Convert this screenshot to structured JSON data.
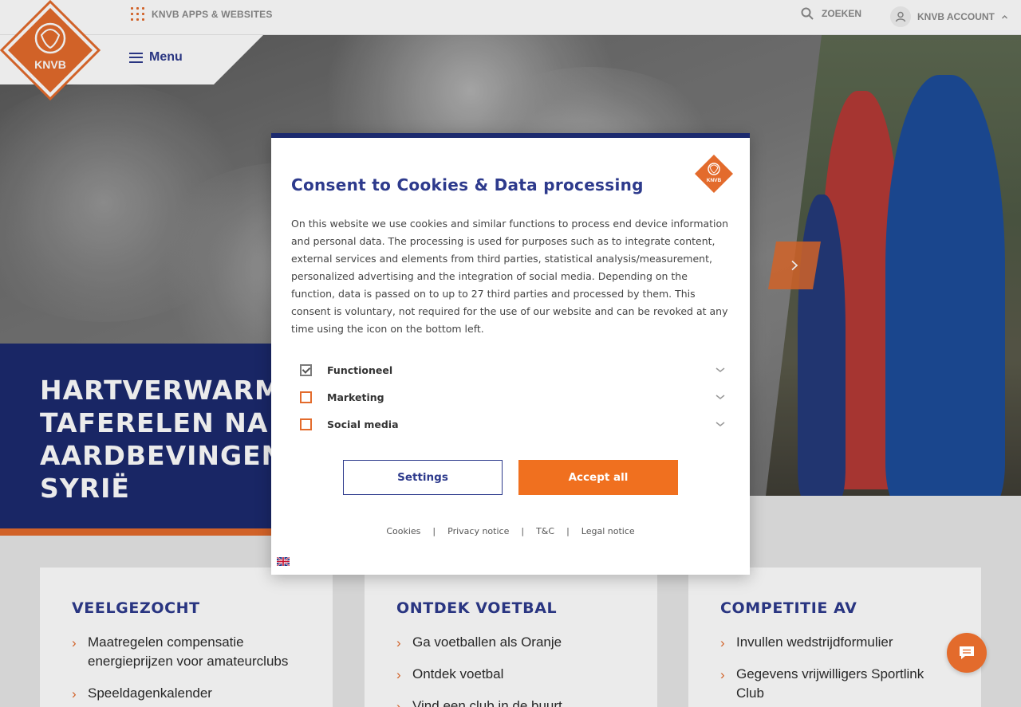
{
  "topbar": {
    "apps_label": "KNVB APPS & WEBSITES",
    "search_label": "ZOEKEN",
    "account_label": "KNVB ACCOUNT"
  },
  "logo": {
    "text": "KNVB"
  },
  "menu": {
    "label": "Menu"
  },
  "hero": {
    "headline": "HARTVERWARMEN TAFERELEN NA AARDBEVINGEN T SYRIË"
  },
  "cards": [
    {
      "title": "VEELGEZOCHT",
      "items": [
        "Maatregelen compensatie energieprijzen voor amateurclubs",
        "Speeldagenkalender"
      ]
    },
    {
      "title": "ONTDEK VOETBAL",
      "items": [
        "Ga voetballen als Oranje",
        "Ontdek voetbal",
        "Vind een club in de buurt"
      ]
    },
    {
      "title": "COMPETITIE AV",
      "items": [
        "Invullen wedstrijdformulier",
        "Gegevens vrijwilligers Sportlink Club"
      ]
    }
  ],
  "modal": {
    "title": "Consent to Cookies & Data processing",
    "text": "On this website we use cookies and similar functions to process end device information and personal data. The processing is used for purposes such as to integrate content, external services and elements from third parties, statistical analysis/measurement, personalized advertising and the integration of social media. Depending on the function, data is passed on to up to 27 third parties and processed by them. This consent is voluntary, not required for the use of our website and can be revoked at any time using the icon on the bottom left.",
    "options": [
      {
        "label": "Functioneel",
        "checked": true
      },
      {
        "label": "Marketing",
        "checked": false
      },
      {
        "label": "Social media",
        "checked": false
      }
    ],
    "settings_label": "Settings",
    "accept_label": "Accept all",
    "links": [
      "Cookies",
      "Privacy notice",
      "T&C",
      "Legal notice"
    ],
    "separator": "|"
  },
  "colors": {
    "brand_orange": "#e36b2c",
    "brand_navy": "#1c2a6e",
    "accent_blue": "#2d3a8c"
  }
}
